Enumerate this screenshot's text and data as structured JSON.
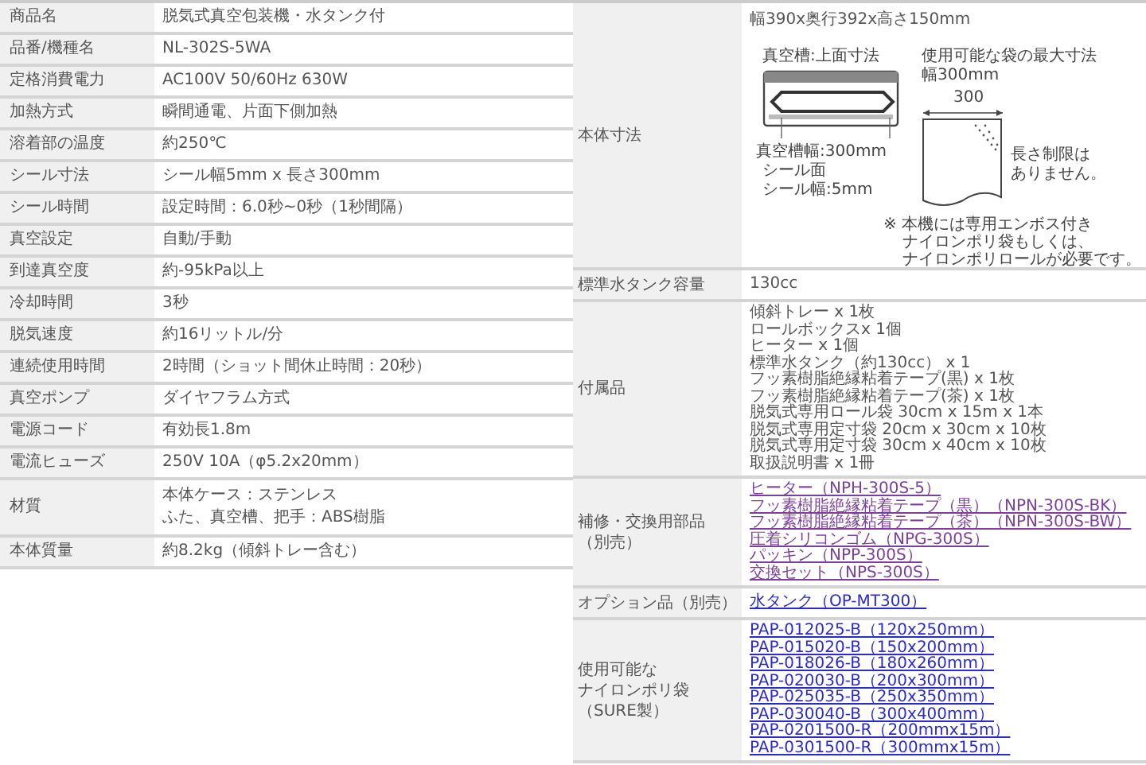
{
  "spec_table": {
    "rows": [
      {
        "label": "商品名",
        "lines": [
          "脱気式真空包装機・水タンク付"
        ]
      },
      {
        "label": "品番/機種名",
        "lines": [
          "NL-302S-5WA"
        ]
      },
      {
        "label": "定格消費電力",
        "lines": [
          "AC100V 50/60Hz 630W"
        ]
      },
      {
        "label": "加熱方式",
        "lines": [
          "瞬間通電、片面下側加熱"
        ]
      },
      {
        "label": "溶着部の温度",
        "lines": [
          "約250℃"
        ]
      },
      {
        "label": "シール寸法",
        "lines": [
          "シール幅5mm x 長さ300mm"
        ]
      },
      {
        "label": "シール時間",
        "lines": [
          "設定時間：6.0秒~0秒（1秒間隔）"
        ]
      },
      {
        "label": "真空設定",
        "lines": [
          "自動/手動"
        ]
      },
      {
        "label": "到達真空度",
        "lines": [
          "約-95kPa以上"
        ]
      },
      {
        "label": "冷却時間",
        "lines": [
          "3秒"
        ]
      },
      {
        "label": "脱気速度",
        "lines": [
          "約16リットル/分"
        ]
      },
      {
        "label": "連続使用時間",
        "lines": [
          "2時間（ショット間休止時間：20秒）"
        ]
      },
      {
        "label": "真空ポンプ",
        "lines": [
          "ダイヤフラム方式"
        ]
      },
      {
        "label": "電源コード",
        "lines": [
          "有効長1.8m"
        ]
      },
      {
        "label": "電流ヒューズ",
        "lines": [
          "250V 10A（φ5.2x20mm）"
        ]
      },
      {
        "label": "材質",
        "lines": [
          "本体ケース：ステンレス",
          "ふた、真空槽、把手：ABS樹脂"
        ]
      },
      {
        "label": "本体質量",
        "lines": [
          "約8.2kg（傾斜トレー含む）"
        ]
      }
    ]
  },
  "detail_table": {
    "rows": [
      {
        "kind": "diagram",
        "label_lines": [
          "本体寸法"
        ],
        "lines": [
          "幅390x奥行392x高さ150mm"
        ],
        "diagram": {
          "chamber_title": "真空槽:上面寸法",
          "chamber_width": "真空槽幅:300mm",
          "seal_lines": [
            "シール面",
            "シール幅:5mm"
          ],
          "bag_title_lines": [
            "使用可能な袋の最大寸法",
            "幅300mm"
          ],
          "bag_dimension": "300",
          "bag_note_lines": [
            "長さ制限は",
            "ありません。"
          ],
          "notice_lines": [
            "※ 本機には専用エンボス付き",
            "ナイロンポリ袋もしくは、",
            "ナイロンポリロールが必要です。"
          ]
        }
      },
      {
        "kind": "text",
        "label_lines": [
          "標準水タンク容量"
        ],
        "lines": [
          "130cc"
        ]
      },
      {
        "kind": "text",
        "label_lines": [
          "付属品"
        ],
        "lines": [
          "傾斜トレー x 1枚",
          "ロールボックスx 1個",
          "ヒーター x 1個",
          "標準水タンク（約130cc） x 1",
          "フッ素樹脂絶縁粘着テープ(黒) x 1枚",
          "フッ素樹脂絶縁粘着テープ(茶) x 1枚",
          "脱気式専用ロール袋 30cm x 15m x 1本",
          "脱気式専用定寸袋 20cm x 30cm x 10枚",
          "脱気式専用定寸袋 30cm x 40cm x 10枚",
          "取扱説明書 x 1冊"
        ]
      },
      {
        "kind": "links",
        "label_lines": [
          "補修・交換用部品",
          "（別売）"
        ],
        "links": [
          {
            "text": "ヒーター（NPH-300S-5）",
            "visited": true
          },
          {
            "text": "フッ素樹脂絶縁粘着テープ（黒）（NPN-300S-BK）",
            "visited": true
          },
          {
            "text": "フッ素樹脂絶縁粘着テープ（茶）（NPN-300S-BW）",
            "visited": true
          },
          {
            "text": "圧着シリコンゴム（NPG-300S）",
            "visited": true
          },
          {
            "text": "パッキン（NPP-300S）",
            "visited": true
          },
          {
            "text": "交換セット（NPS-300S）",
            "visited": true
          }
        ]
      },
      {
        "kind": "links",
        "label_lines": [
          "オプション品（別売）"
        ],
        "links": [
          {
            "text": "水タンク（OP-MT300）",
            "visited": false
          }
        ]
      },
      {
        "kind": "links",
        "label_lines": [
          "使用可能な",
          "ナイロンポリ袋",
          "（SURE製）"
        ],
        "links": [
          {
            "text": "PAP-012025-B（120x250mm）",
            "visited": false
          },
          {
            "text": "PAP-015020-B（150x200mm）",
            "visited": false
          },
          {
            "text": "PAP-018026-B（180x260mm）",
            "visited": false
          },
          {
            "text": "PAP-020030-B（200x300mm）",
            "visited": false
          },
          {
            "text": "PAP-025035-B（250x350mm）",
            "visited": false
          },
          {
            "text": "PAP-030040-B（300x400mm）",
            "visited": false
          },
          {
            "text": "PAP-0201500-R（200mmx15m）",
            "visited": false
          },
          {
            "text": "PAP-0301500-R（300mmx15m）",
            "visited": false
          }
        ]
      }
    ]
  }
}
